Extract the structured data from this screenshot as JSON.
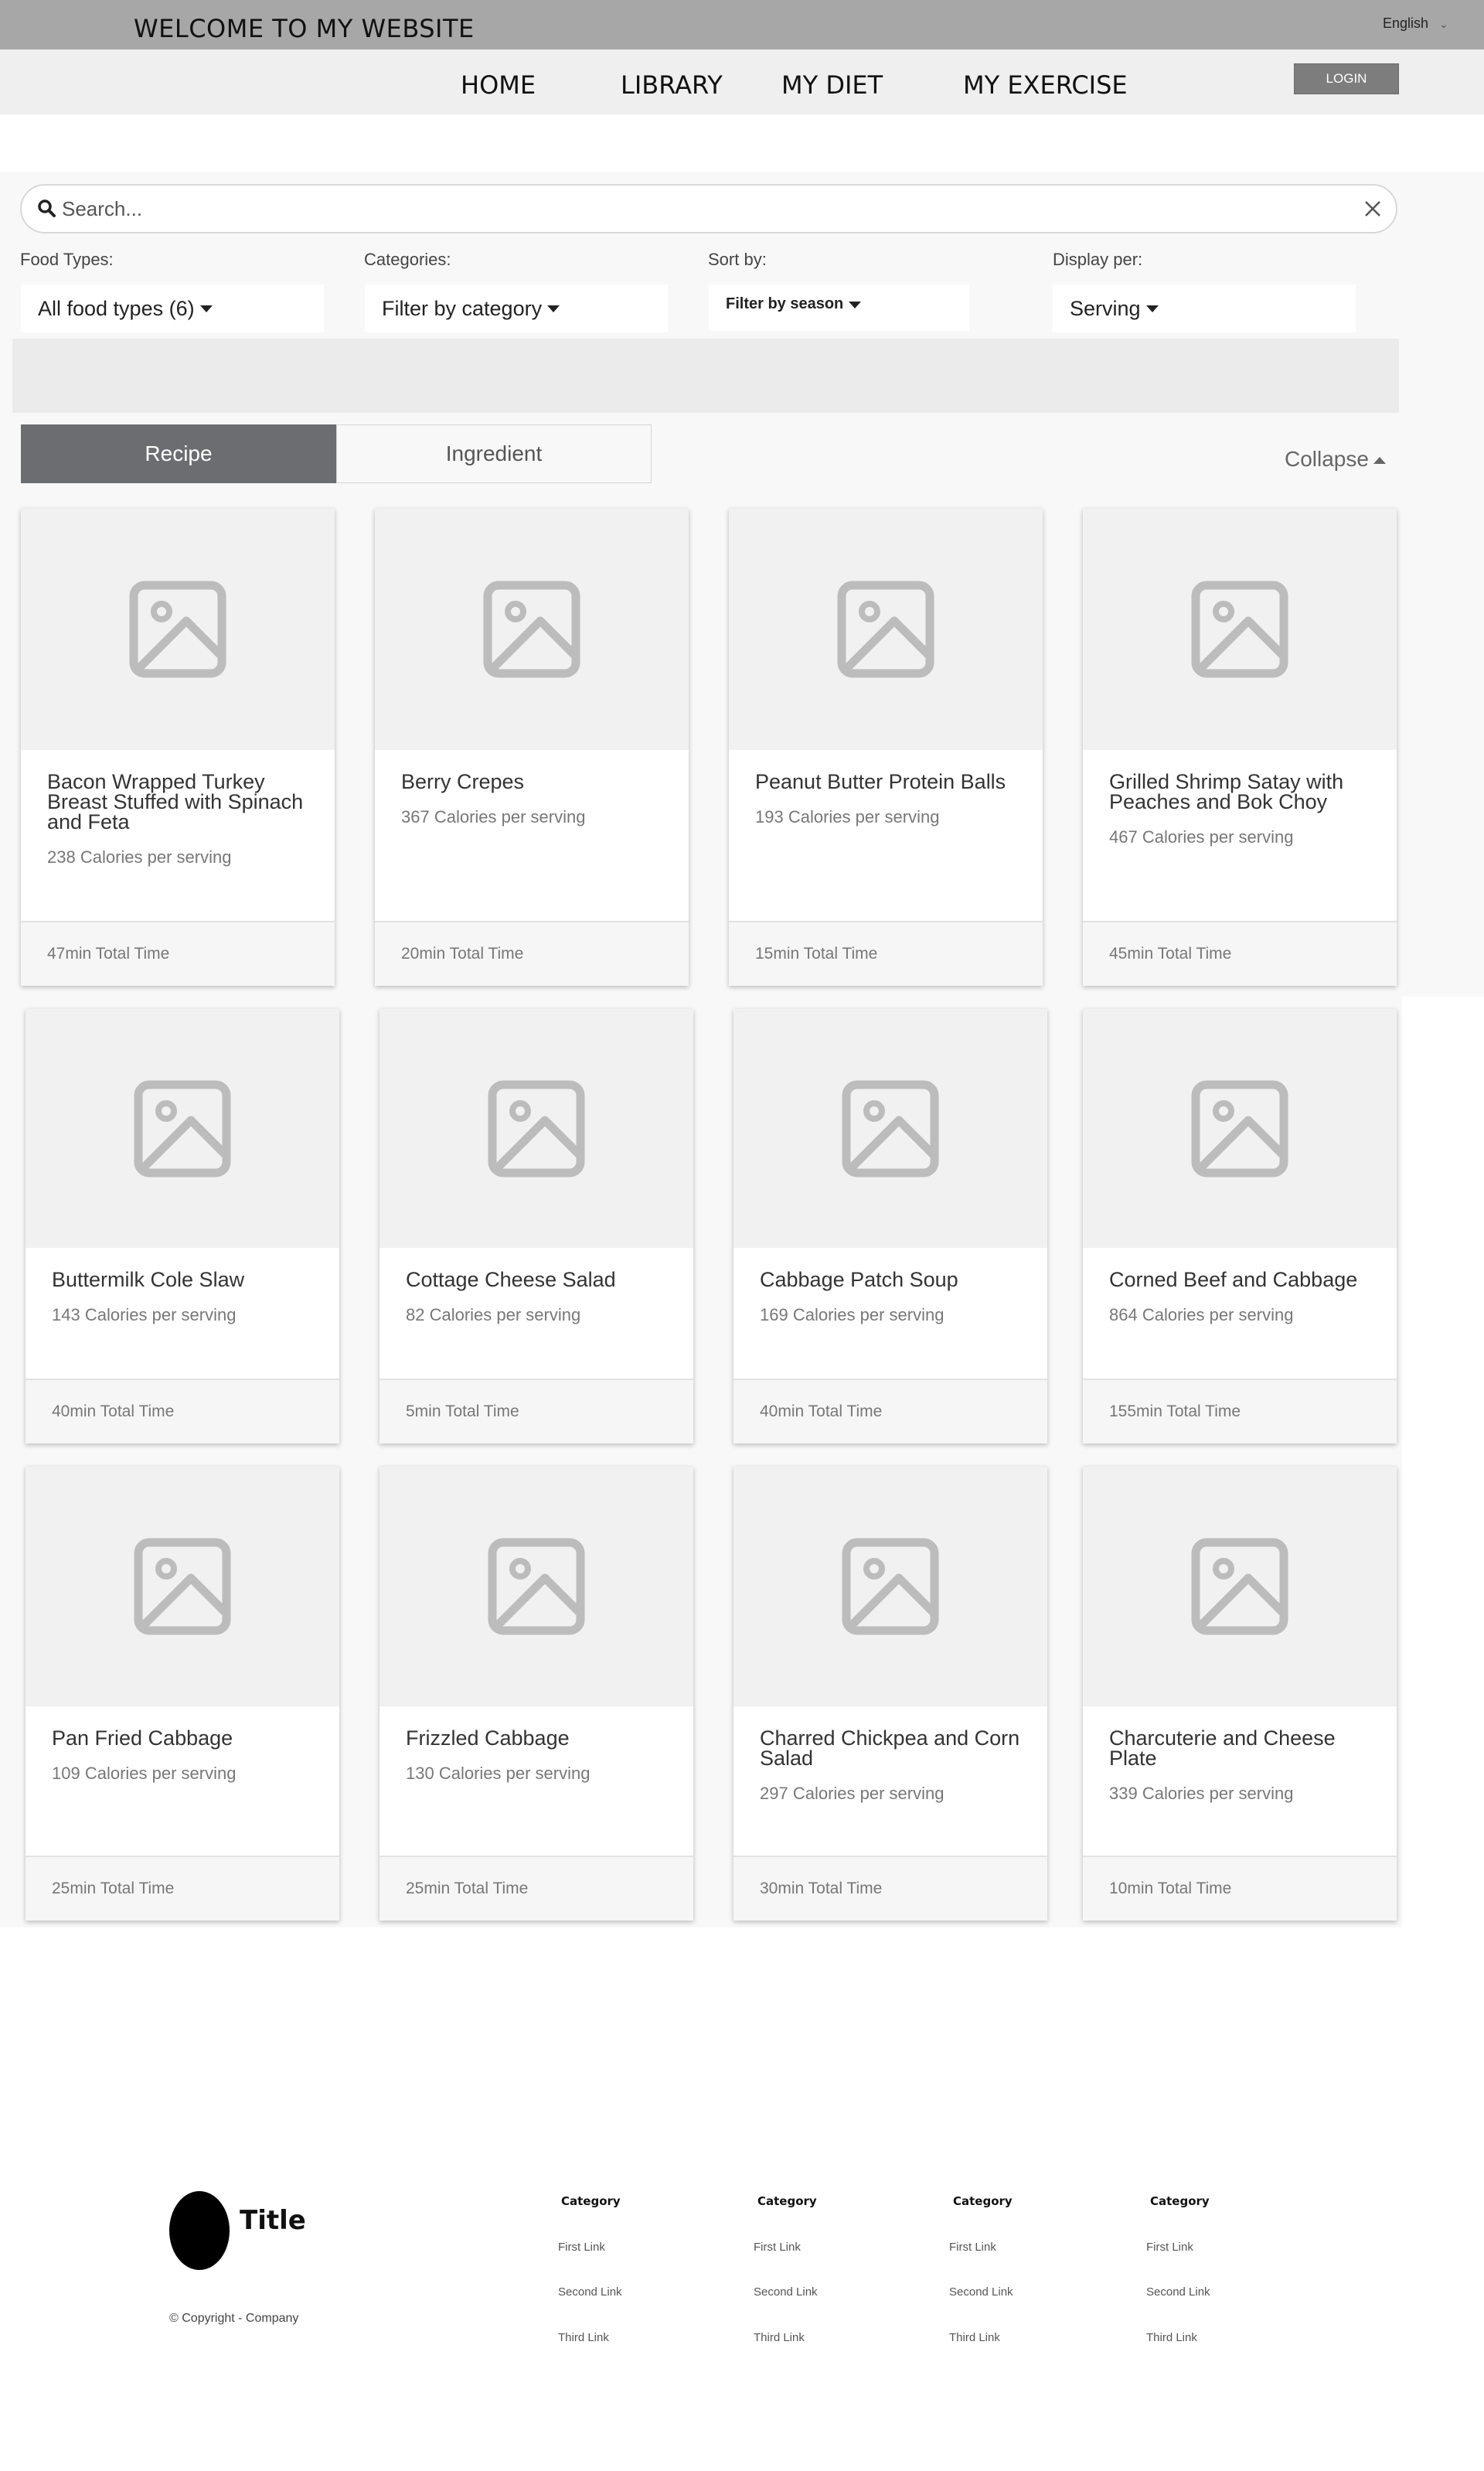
{
  "header": {
    "site_title": "WELCOME TO MY WEBSITE",
    "language": "English",
    "nav": [
      {
        "label": "HOME"
      },
      {
        "label": "LIBRARY"
      },
      {
        "label": "MY DIET"
      },
      {
        "label": "MY EXERCISE"
      }
    ],
    "login_label": "LOGIN"
  },
  "search": {
    "placeholder": "Search..."
  },
  "filters": {
    "food_types_label": "Food Types:",
    "food_types_value": "All food types (6)",
    "categories_label": "Categories:",
    "categories_value": "Filter by category",
    "sort_label": "Sort by:",
    "sort_value": "Filter by season",
    "display_label": "Display per:",
    "display_value": "Serving"
  },
  "tabs": {
    "recipe": "Recipe",
    "ingredient": "Ingredient",
    "collapse": "Collapse"
  },
  "cards": [
    {
      "title": "Bacon Wrapped Turkey Breast Stuffed with Spinach and Feta",
      "calories": "238 Calories per serving",
      "time": "47min Total Time"
    },
    {
      "title": "Berry Crepes",
      "calories": "367 Calories per serving",
      "time": "20min Total Time"
    },
    {
      "title": "Peanut Butter Protein Balls",
      "calories": "193 Calories per serving",
      "time": "15min Total Time"
    },
    {
      "title": "Grilled Shrimp Satay with Peaches and Bok Choy",
      "calories": "467 Calories per serving",
      "time": "45min Total Time"
    },
    {
      "title": "Buttermilk Cole Slaw",
      "calories": "143 Calories per serving",
      "time": "40min Total Time"
    },
    {
      "title": "Cottage Cheese Salad",
      "calories": "82 Calories per serving",
      "time": "5min Total Time"
    },
    {
      "title": "Cabbage Patch Soup",
      "calories": "169 Calories per serving",
      "time": "40min Total Time"
    },
    {
      "title": "Corned Beef and Cabbage",
      "calories": "864 Calories per serving",
      "time": "155min Total Time"
    },
    {
      "title": "Pan Fried Cabbage",
      "calories": "109 Calories per serving",
      "time": "25min Total Time"
    },
    {
      "title": "Frizzled Cabbage",
      "calories": "130 Calories per serving",
      "time": "25min Total Time"
    },
    {
      "title": "Charred Chickpea and Corn Salad",
      "calories": "297 Calories per serving",
      "time": "30min Total Time"
    },
    {
      "title": "Charcuterie and Cheese Plate",
      "calories": "339 Calories per serving",
      "time": "10min Total Time"
    }
  ],
  "footer": {
    "title": "Title",
    "copyright": "© Copyright - Company",
    "columns": [
      {
        "category": "Category",
        "links": [
          "First Link",
          "Second Link",
          "Third Link"
        ]
      },
      {
        "category": "Category",
        "links": [
          "First Link",
          "Second Link",
          "Third Link"
        ]
      },
      {
        "category": "Category",
        "links": [
          "First Link",
          "Second Link",
          "Third Link"
        ]
      },
      {
        "category": "Category",
        "links": [
          "First Link",
          "Second Link",
          "Third Link"
        ]
      }
    ]
  }
}
